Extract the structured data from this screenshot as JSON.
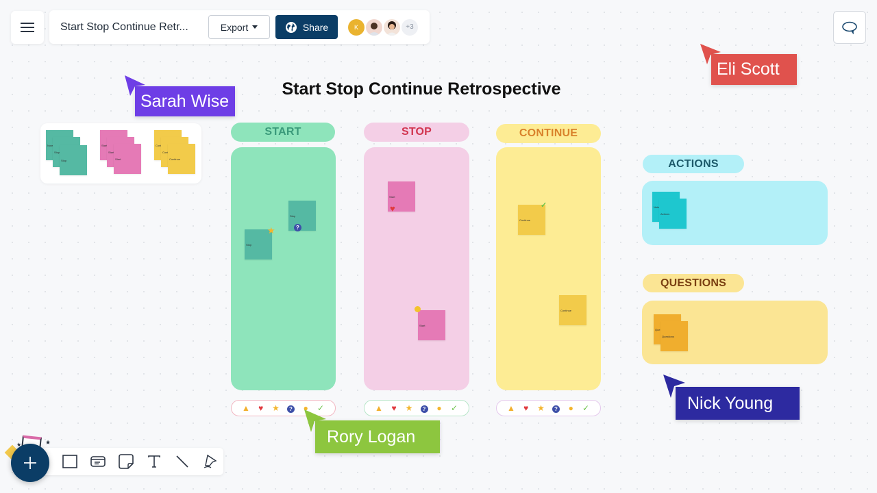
{
  "toolbar": {
    "menu_icon": "hamburger-icon",
    "document_title": "Start Stop Continue Retr...",
    "export_label": "Export",
    "share_label": "Share",
    "share_icon": "globe-icon",
    "collaborators": [
      {
        "initial": "K",
        "color": "#eab32f"
      },
      {
        "type": "photo"
      },
      {
        "type": "photo"
      }
    ],
    "more_collaborators": "+3",
    "comment_icon": "comment-icon"
  },
  "board": {
    "title": "Start Stop Continue Retrospective",
    "columns": [
      {
        "key": "start",
        "label": "START",
        "header_bg": "#8ee4bb",
        "header_color": "#3a9a7a",
        "body_bg": "#8ee4bb",
        "sticky_color": "#55b9a3",
        "notes": [
          {
            "text": "Stop",
            "reaction": "question-icon"
          },
          {
            "text": "Stop",
            "reaction": "star-icon"
          }
        ]
      },
      {
        "key": "stop",
        "label": "STOP",
        "header_bg": "#f4cfe6",
        "header_color": "#d1344f",
        "body_bg": "#f4cfe6",
        "sticky_color": "#e57ab6",
        "notes": [
          {
            "text": "Start",
            "reaction": "heart-icon"
          },
          {
            "text": "Start",
            "reaction": "bulb-icon"
          }
        ]
      },
      {
        "key": "continue",
        "label": "CONTINUE",
        "header_bg": "#fdec94",
        "header_color": "#d9822b",
        "body_bg": "#fdec94",
        "sticky_color": "#f2cb4a",
        "notes": [
          {
            "text": "Continue",
            "reaction": "check-icon"
          },
          {
            "text": "Continue",
            "reaction": ""
          }
        ]
      }
    ],
    "reactions": [
      {
        "icon": "thumbs-up-icon",
        "glyph": "👍"
      },
      {
        "icon": "heart-icon",
        "glyph": "♥"
      },
      {
        "icon": "star-icon",
        "glyph": "★"
      },
      {
        "icon": "question-icon",
        "glyph": "?"
      },
      {
        "icon": "bulb-icon",
        "glyph": "●"
      },
      {
        "icon": "check-icon",
        "glyph": "✓"
      }
    ],
    "side_sections": [
      {
        "key": "actions",
        "label": "ACTIONS",
        "header_bg": "#b3f0f8",
        "header_color": "#1d5a6a",
        "body_bg": "#b3f0f8",
        "sticky_color": "#1ec7cf",
        "notes": [
          "Note",
          "Actions"
        ]
      },
      {
        "key": "questions",
        "label": "QUESTIONS",
        "header_bg": "#fbe594",
        "header_color": "#7a4012",
        "body_bg": "#fbe594",
        "sticky_color": "#f0ae2e",
        "notes": [
          "Que",
          "Questions"
        ]
      }
    ],
    "palette": [
      {
        "color": "#55b9a3",
        "notes": [
          "Note",
          "Stop",
          "Stop"
        ]
      },
      {
        "color": "#e57ab6",
        "notes": [
          "Start",
          "Start",
          "Start"
        ]
      },
      {
        "color": "#f2cb4a",
        "notes": [
          "Cont",
          "Cont",
          "Continue"
        ]
      }
    ]
  },
  "cursors": [
    {
      "name": "Sarah Wise",
      "color": "#6e3ee6"
    },
    {
      "name": "Eli Scott",
      "color": "#e0524d"
    },
    {
      "name": "Rory Logan",
      "color": "#8dc63f"
    },
    {
      "name": "Nick Young",
      "color": "#2d2aa0"
    }
  ],
  "bottom_toolbar": {
    "add_icon": "plus-icon",
    "tools": [
      "rectangle-icon",
      "card-icon",
      "sticky-note-icon",
      "text-icon",
      "line-icon",
      "pen-icon"
    ]
  }
}
